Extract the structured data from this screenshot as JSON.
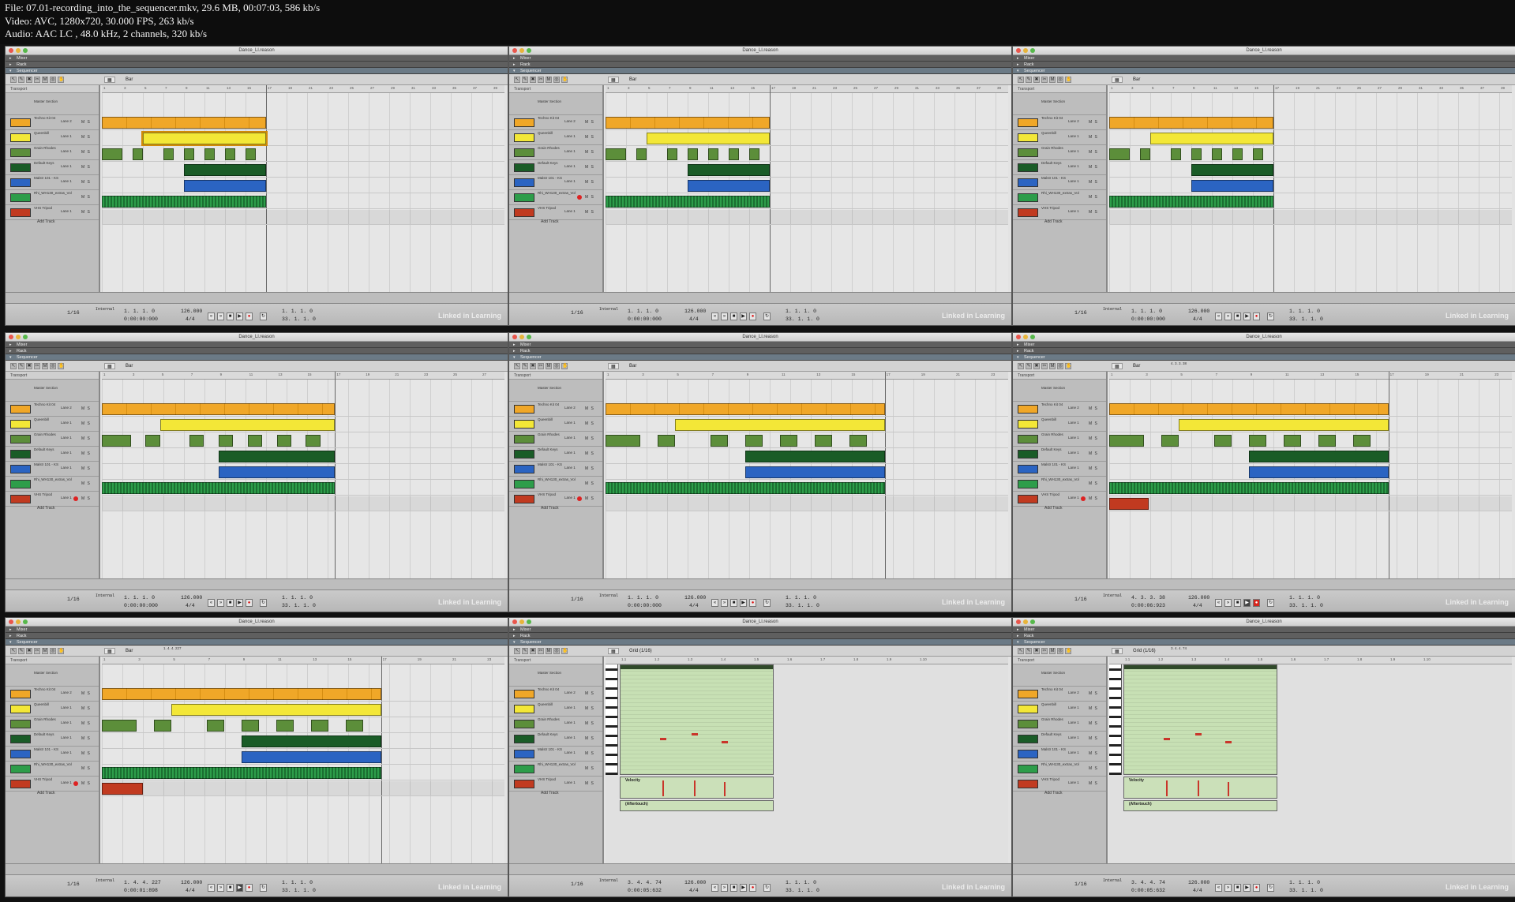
{
  "file_info": {
    "line1": "File: 07.01-recording_into_the_sequencer.mkv, 29.6 MB, 00:07:03, 586 kb/s",
    "line2": "Video: AVC, 1280x720, 30.000 FPS, 263 kb/s",
    "line3": "Audio: AAC LC , 48.0 kHz, 2 channels, 320 kb/s"
  },
  "window": {
    "title": "Dance_Ll.reason",
    "panels": [
      "Mixer",
      "Rack",
      "Sequencer"
    ]
  },
  "toolbar": {
    "snap_label": "Bar",
    "grid_label": "Grid (1/16)"
  },
  "tracklist": {
    "header": "Transport",
    "master": "Master Section",
    "add_track": "Add Track",
    "tracks": [
      {
        "name": "Techno Kit 04",
        "lane": "Lane 2",
        "color": "#f0a728"
      },
      {
        "name": "Queenbill",
        "lane": "Lane 1",
        "color": "#f3e737"
      },
      {
        "name": "Grain Rhodes",
        "lane": "Lane 1",
        "color": "#5c8e3a"
      },
      {
        "name": "Default Keys",
        "lane": "Lane 1",
        "color": "#1a5c27"
      },
      {
        "name": "Malstr 101 - KS",
        "lane": "Lane 1",
        "color": "#2b64c2"
      },
      {
        "name": "Rhi_WH130_extras_Vol",
        "lane": "",
        "color": "#2d9d4a"
      },
      {
        "name": "VHS Tripod",
        "lane": "Lane 1",
        "color": "#c13a20"
      }
    ]
  },
  "editor": {
    "velocity_label": "Velocity",
    "aftertouch_label": "(Aftertouch)"
  },
  "frames": [
    {
      "id": "f1",
      "pos": "1. 1. 1. 0",
      "time": "0:00:00:000",
      "loop_l": "1. 1. 1. 0",
      "loop_r": "33. 1. 1. 0"
    },
    {
      "id": "f2",
      "pos": "1. 1. 1. 0",
      "time": "0:00:00:000",
      "loop_l": "1. 1. 1. 0",
      "loop_r": "33. 1. 1. 0"
    },
    {
      "id": "f3",
      "pos": "1. 1. 1. 0",
      "time": "0:00:00:000",
      "loop_l": "1. 1. 1. 0",
      "loop_r": "33. 1. 1. 0"
    },
    {
      "id": "f4",
      "pos": "1. 1. 1. 0",
      "time": "0:00:00:000",
      "loop_l": "1. 1. 1. 0",
      "loop_r": "33. 1. 1. 0"
    },
    {
      "id": "f5",
      "pos": "1. 1. 1. 0",
      "time": "0:00:00:000",
      "loop_l": "1. 1. 1. 0",
      "loop_r": "33. 1. 1. 0"
    },
    {
      "id": "f6",
      "pos": "4. 3. 3. 38",
      "time": "0:00:06:923",
      "loop_l": "1. 1. 1. 0",
      "loop_r": "33. 1. 1. 0"
    },
    {
      "id": "f7",
      "pos": "1. 4. 4. 227",
      "time": "0:00:01:898",
      "loop_l": "1. 1. 1. 0",
      "loop_r": "33. 1. 1. 0"
    },
    {
      "id": "f8",
      "pos": "3. 4. 4. 74",
      "time": "0:00:05:632",
      "loop_l": "1. 1. 1. 0",
      "loop_r": "33. 1. 1. 0"
    },
    {
      "id": "f9",
      "pos": "3. 4. 4. 74",
      "time": "0:00:05:632",
      "loop_l": "1. 1. 1. 0",
      "loop_r": "33. 1. 1. 0"
    }
  ],
  "transport": {
    "tempo": "126.000",
    "signature": "4/4",
    "quantize": "1/16",
    "sync": "Internal"
  },
  "watermark": "Linked in Learning"
}
